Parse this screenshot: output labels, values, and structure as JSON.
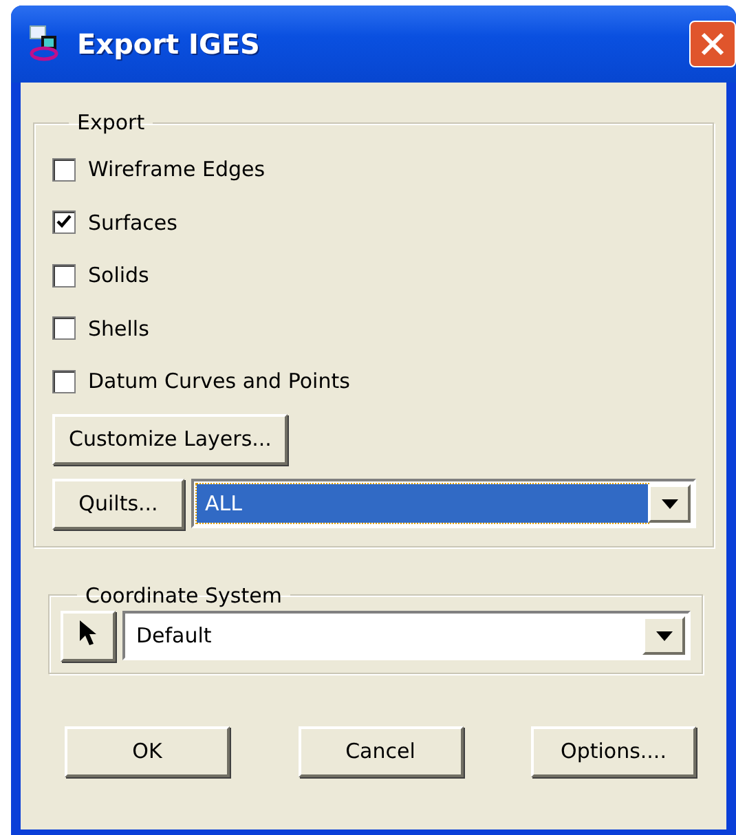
{
  "window": {
    "title": "Export IGES"
  },
  "export_group": {
    "legend": "Export",
    "options": [
      {
        "label": "Wireframe Edges",
        "checked": false
      },
      {
        "label": "Surfaces",
        "checked": true
      },
      {
        "label": "Solids",
        "checked": false
      },
      {
        "label": "Shells",
        "checked": false
      },
      {
        "label": "Datum Curves and Points",
        "checked": false
      }
    ],
    "customize_button": "Customize Layers...",
    "quilts_button": "Quilts...",
    "quilts_select": {
      "value": "ALL",
      "selected": true
    }
  },
  "coordinate_group": {
    "legend": "Coordinate System",
    "select": {
      "value": "Default",
      "selected": false
    }
  },
  "buttons": [
    "OK",
    "Cancel",
    "Options...."
  ]
}
